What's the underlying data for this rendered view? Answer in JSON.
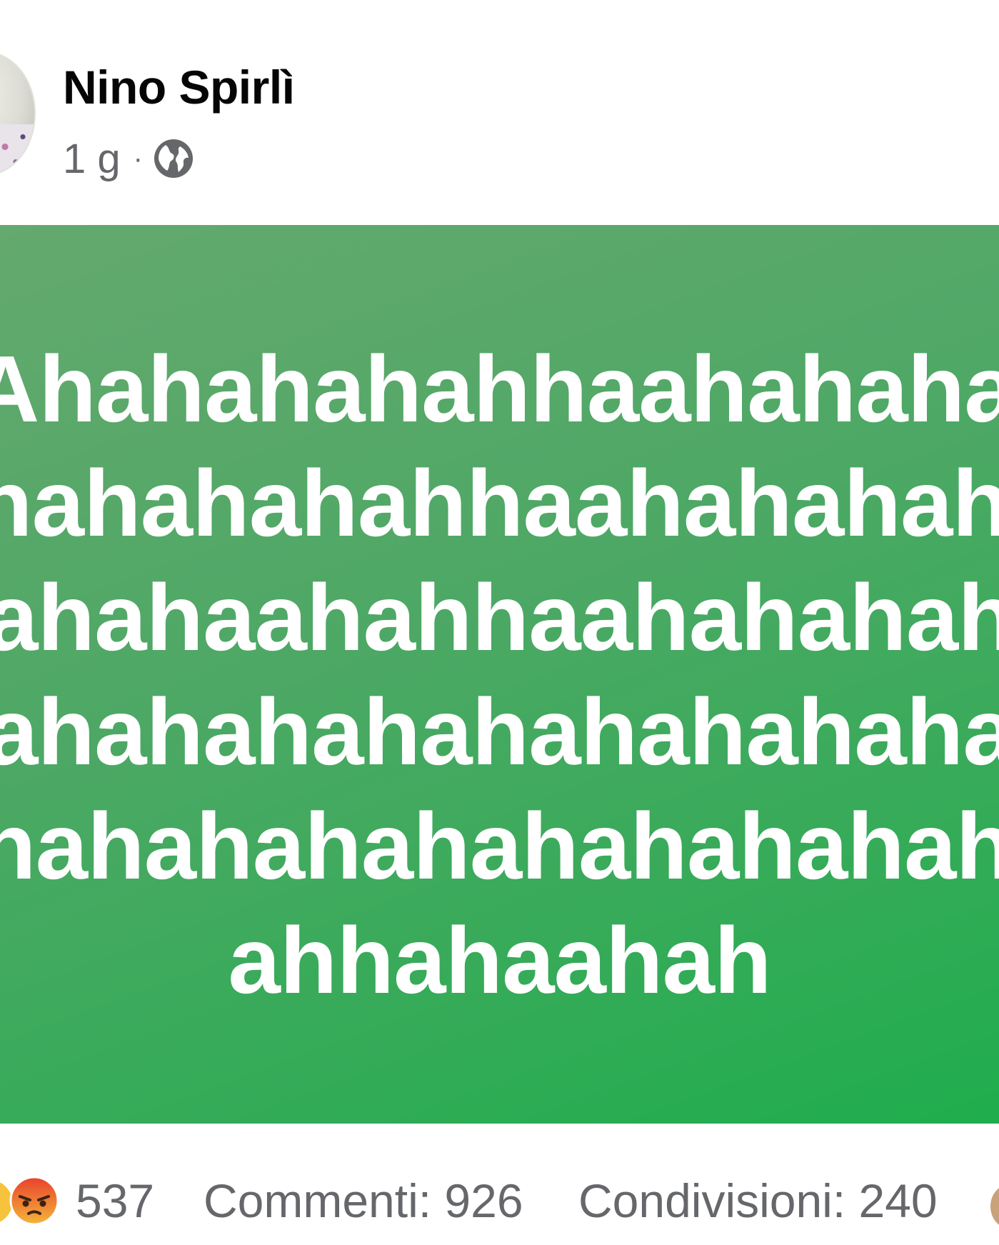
{
  "post": {
    "author": "Nino Spirlì",
    "time": "1 g",
    "separator": "·",
    "privacy_icon": "globe-icon"
  },
  "background_post": {
    "bg_colors": [
      "#64a96e",
      "#1fad4e"
    ],
    "lines": [
      "Ahahahahahhaahahahaha",
      "nahahahahhaahahahahah",
      "ahahaahahhaahahahahah",
      "ahahahahahahahahahaha",
      "nahahahahahahahahahha",
      "ahhahaahah"
    ]
  },
  "footer": {
    "reaction_icons": [
      "haha-icon",
      "angry-icon"
    ],
    "reaction_count": "537",
    "comments": "Commenti: 926",
    "shares": "Condivisioni: 240"
  }
}
